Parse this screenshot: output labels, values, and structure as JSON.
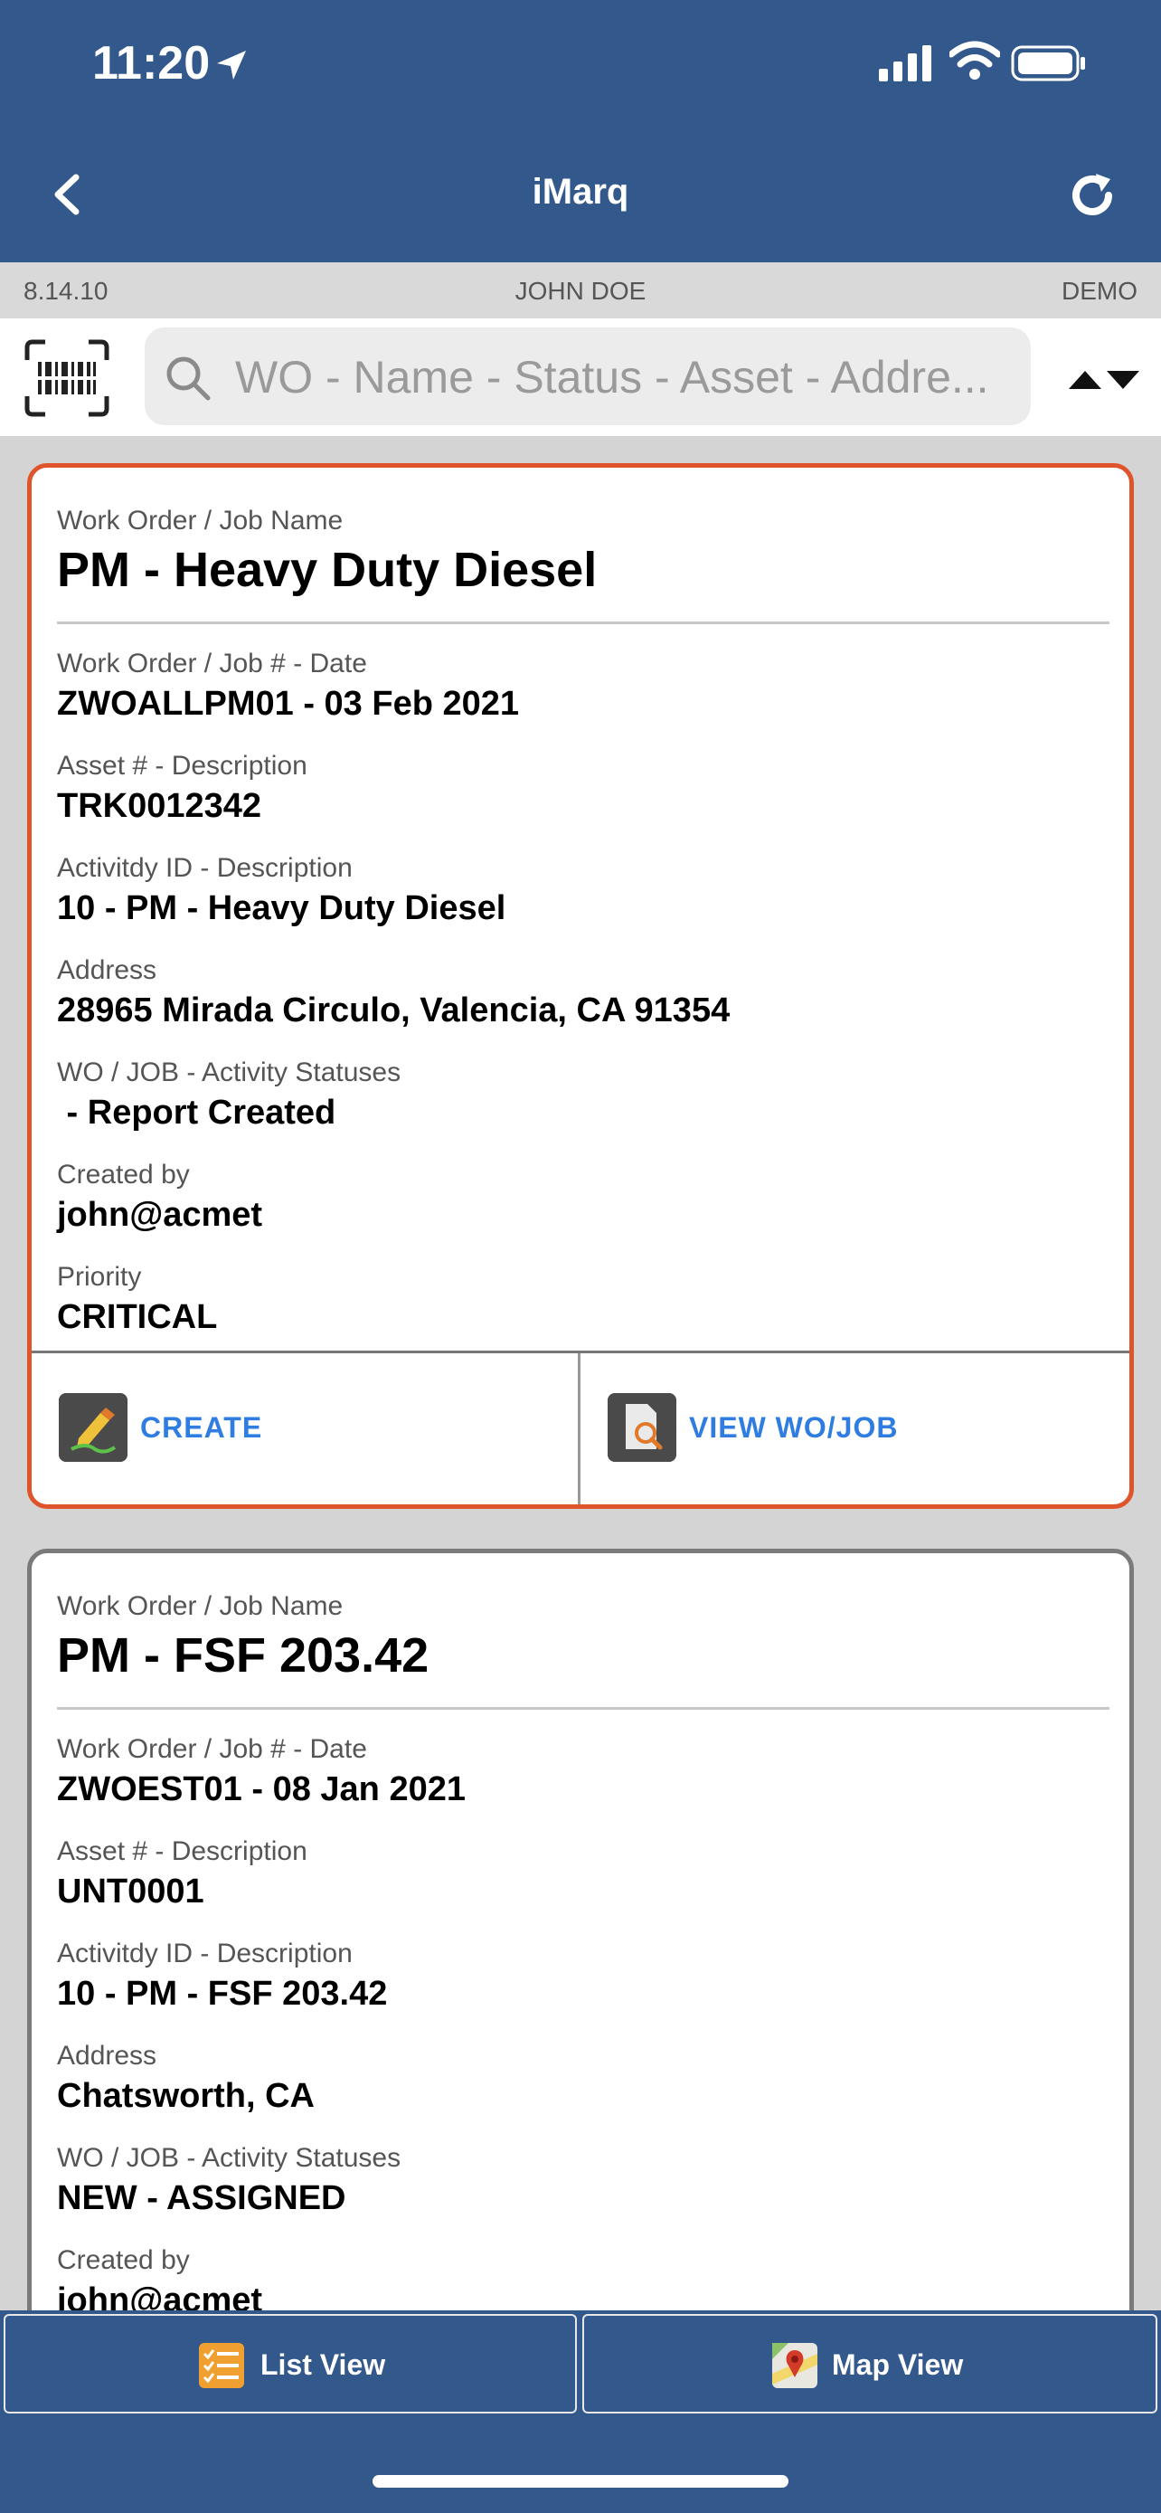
{
  "status_bar": {
    "time": "11:20"
  },
  "nav": {
    "title": "iMarq"
  },
  "info_bar": {
    "version": "8.14.10",
    "user": "JOHN DOE",
    "environment": "DEMO"
  },
  "search": {
    "placeholder": "WO - Name - Status - Asset - Addre..."
  },
  "cards": [
    {
      "name_label": "Work Order / Job Name",
      "name": "PM - Heavy Duty Diesel",
      "wo_label": "Work Order / Job # - Date",
      "wo": "ZWOALLPM01 - 03 Feb 2021",
      "asset_label": "Asset # - Description",
      "asset": "TRK0012342",
      "activity_label": "Activitdy ID - Description",
      "activity": "10 - PM - Heavy Duty Diesel",
      "address_label": "Address",
      "address": "28965 Mirada Circulo, Valencia, CA 91354",
      "statuses_label": "WO / JOB - Activity Statuses",
      "statuses": " - Report Created",
      "created_label": "Created by",
      "created": "john@acmet",
      "priority_label": "Priority",
      "priority": "CRITICAL",
      "create_label": "CREATE",
      "view_label": "VIEW WO/JOB"
    },
    {
      "name_label": "Work Order / Job Name",
      "name": "PM - FSF 203.42",
      "wo_label": "Work Order / Job # - Date",
      "wo": "ZWOEST01 - 08 Jan 2021",
      "asset_label": "Asset # - Description",
      "asset": "UNT0001",
      "activity_label": "Activitdy ID - Description",
      "activity": "10 - PM - FSF 203.42",
      "address_label": "Address",
      "address": "Chatsworth, CA",
      "statuses_label": "WO / JOB - Activity Statuses",
      "statuses": "NEW - ASSIGNED",
      "created_label": "Created by",
      "created": "john@acmet"
    }
  ],
  "bottom_tabs": {
    "list_view": "List View",
    "map_view": "Map View"
  },
  "colors": {
    "header": "#33588c",
    "accent_border": "#e0542c",
    "link": "#2f7de1"
  }
}
